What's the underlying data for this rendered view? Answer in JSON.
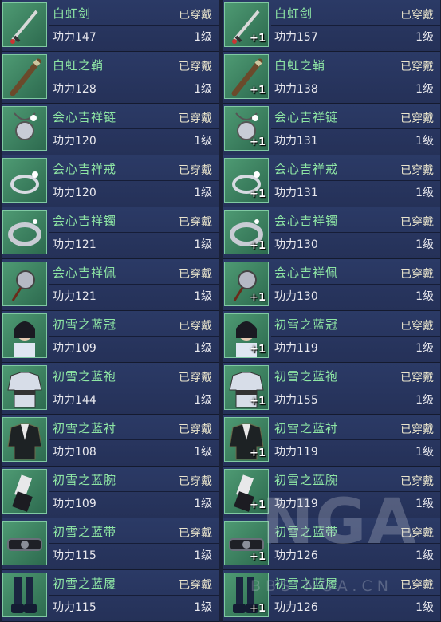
{
  "left": [
    {
      "icon": "sword-icon",
      "name": "白虹剑",
      "status": "已穿戴",
      "power": "功力147",
      "level": "1级"
    },
    {
      "icon": "scabbard-icon",
      "name": "白虹之鞘",
      "status": "已穿戴",
      "power": "功力128",
      "level": "1级"
    },
    {
      "icon": "necklace-icon",
      "name": "会心吉祥链",
      "status": "已穿戴",
      "power": "功力120",
      "level": "1级"
    },
    {
      "icon": "ring-icon",
      "name": "会心吉祥戒",
      "status": "已穿戴",
      "power": "功力120",
      "level": "1级"
    },
    {
      "icon": "bracelet-icon",
      "name": "会心吉祥镯",
      "status": "已穿戴",
      "power": "功力121",
      "level": "1级"
    },
    {
      "icon": "pendant-icon",
      "name": "会心吉祥佩",
      "status": "已穿戴",
      "power": "功力121",
      "level": "1级"
    },
    {
      "icon": "crown-icon",
      "name": "初雪之蓝冠",
      "status": "已穿戴",
      "power": "功力109",
      "level": "1级"
    },
    {
      "icon": "robe-icon",
      "name": "初雪之蓝袍",
      "status": "已穿戴",
      "power": "功力144",
      "level": "1级"
    },
    {
      "icon": "shirt-icon",
      "name": "初雪之蓝衬",
      "status": "已穿戴",
      "power": "功力108",
      "level": "1级"
    },
    {
      "icon": "bracer-icon",
      "name": "初雪之蓝腕",
      "status": "已穿戴",
      "power": "功力109",
      "level": "1级"
    },
    {
      "icon": "belt-icon",
      "name": "初雪之蓝带",
      "status": "已穿戴",
      "power": "功力115",
      "level": "1级"
    },
    {
      "icon": "boots-icon",
      "name": "初雪之蓝履",
      "status": "已穿戴",
      "power": "功力115",
      "level": "1级"
    }
  ],
  "right": [
    {
      "icon": "sword-icon",
      "name": "白虹剑",
      "status": "已穿戴",
      "power": "功力157",
      "level": "1级",
      "upgrade": "+1"
    },
    {
      "icon": "scabbard-icon",
      "name": "白虹之鞘",
      "status": "已穿戴",
      "power": "功力138",
      "level": "1级",
      "upgrade": "+1"
    },
    {
      "icon": "necklace-icon",
      "name": "会心吉祥链",
      "status": "已穿戴",
      "power": "功力131",
      "level": "1级",
      "upgrade": "+1"
    },
    {
      "icon": "ring-icon",
      "name": "会心吉祥戒",
      "status": "已穿戴",
      "power": "功力131",
      "level": "1级",
      "upgrade": "+1"
    },
    {
      "icon": "bracelet-icon",
      "name": "会心吉祥镯",
      "status": "已穿戴",
      "power": "功力130",
      "level": "1级",
      "upgrade": "+1"
    },
    {
      "icon": "pendant-icon",
      "name": "会心吉祥佩",
      "status": "已穿戴",
      "power": "功力130",
      "level": "1级",
      "upgrade": "+1"
    },
    {
      "icon": "crown-icon",
      "name": "初雪之蓝冠",
      "status": "已穿戴",
      "power": "功力119",
      "level": "1级",
      "upgrade": "+1"
    },
    {
      "icon": "robe-icon",
      "name": "初雪之蓝袍",
      "status": "已穿戴",
      "power": "功力155",
      "level": "1级",
      "upgrade": "+1"
    },
    {
      "icon": "shirt-icon",
      "name": "初雪之蓝衬",
      "status": "已穿戴",
      "power": "功力119",
      "level": "1级",
      "upgrade": "+1"
    },
    {
      "icon": "bracer-icon",
      "name": "初雪之蓝腕",
      "status": "已穿戴",
      "power": "功力119",
      "level": "1级",
      "upgrade": "+1"
    },
    {
      "icon": "belt-icon",
      "name": "初雪之蓝带",
      "status": "已穿戴",
      "power": "功力126",
      "level": "1级",
      "upgrade": "+1"
    },
    {
      "icon": "boots-icon",
      "name": "初雪之蓝履",
      "status": "已穿戴",
      "power": "功力126",
      "level": "1级",
      "upgrade": "+1"
    }
  ],
  "watermark": {
    "logo": "NGA",
    "site": "BBS.NGA.CN"
  },
  "colors": {
    "name_text": "#8ee6a4",
    "status_text": "#e9e4cc",
    "row_bg": "#2b3a66",
    "icon_bg": "#3f8a63"
  }
}
